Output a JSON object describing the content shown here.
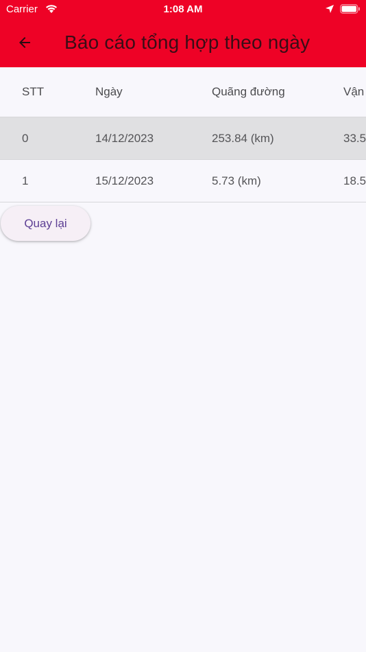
{
  "status_bar": {
    "carrier": "Carrier",
    "time": "1:08 AM"
  },
  "header": {
    "title": "Báo cáo tổng hợp theo ngày",
    "back_icon": "arrow-back-icon",
    "background_color": "#ee0226"
  },
  "table": {
    "columns": [
      "STT",
      "Ngày",
      "Quãng đường",
      "Vận"
    ],
    "rows": [
      {
        "stt": "0",
        "date": "14/12/2023",
        "distance": "253.84 (km)",
        "speed": "33.5",
        "selected": true
      },
      {
        "stt": "1",
        "date": "15/12/2023",
        "distance": "5.73 (km)",
        "speed": "18.5",
        "selected": false
      }
    ]
  },
  "actions": {
    "back_label": "Quay lại"
  }
}
